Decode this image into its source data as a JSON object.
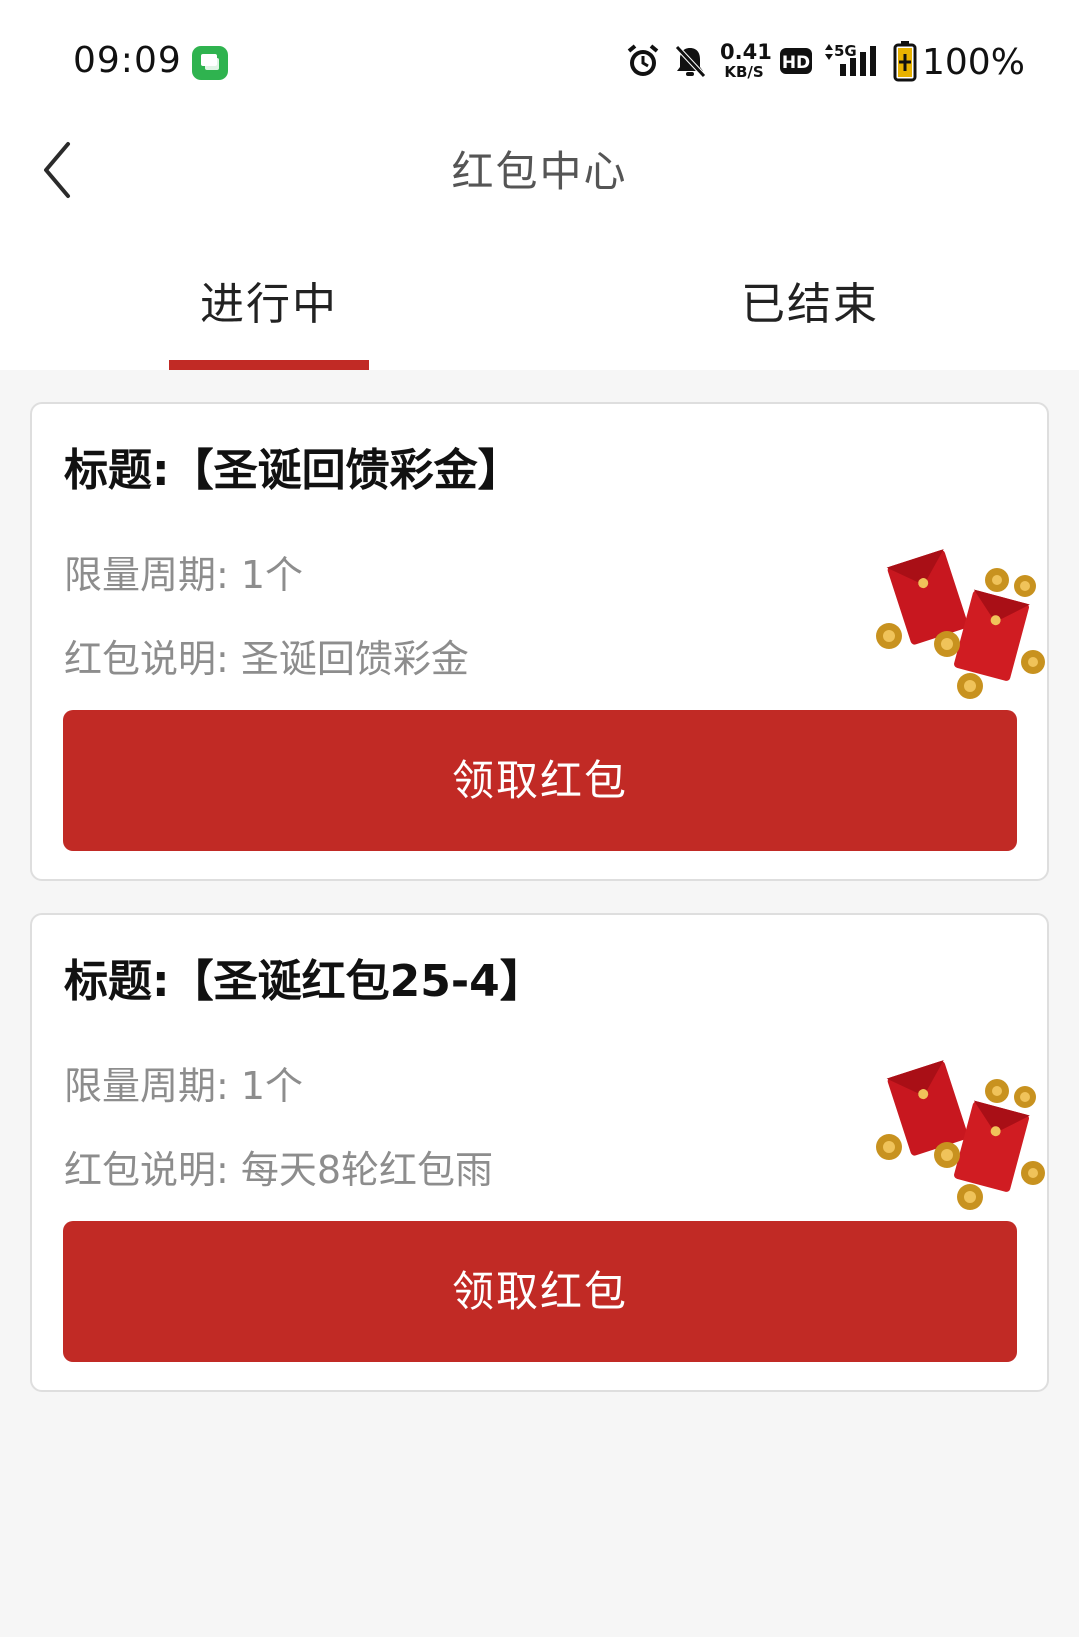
{
  "status_bar": {
    "time": "09:09",
    "net_speed_value": "0.41",
    "net_speed_unit": "KB/S",
    "battery_percent": "100%",
    "icons": [
      "message-app-icon",
      "alarm-icon",
      "mute-bell-icon",
      "hd-icon",
      "5g-signal-icon",
      "battery-charging-icon"
    ]
  },
  "header": {
    "title": "红包中心",
    "back_icon": "chevron-left-icon"
  },
  "tabs": [
    {
      "label": "进行中",
      "active": true
    },
    {
      "label": "已结束",
      "active": false
    }
  ],
  "theme": {
    "accent": "#c12a25",
    "page_bg": "#f6f6f6",
    "muted_text": "#8d8d8d"
  },
  "cards": [
    {
      "title": "标题:【圣诞回馈彩金】",
      "limit_text": "限量周期: 1个",
      "desc_text": "红包说明: 圣诞回馈彩金",
      "button_label": "领取红包",
      "decor_icon": "red-envelopes-coins-icon"
    },
    {
      "title": "标题:【圣诞红包25-4】",
      "limit_text": "限量周期: 1个",
      "desc_text": "红包说明: 每天8轮红包雨",
      "button_label": "领取红包",
      "decor_icon": "red-envelopes-coins-icon"
    }
  ]
}
